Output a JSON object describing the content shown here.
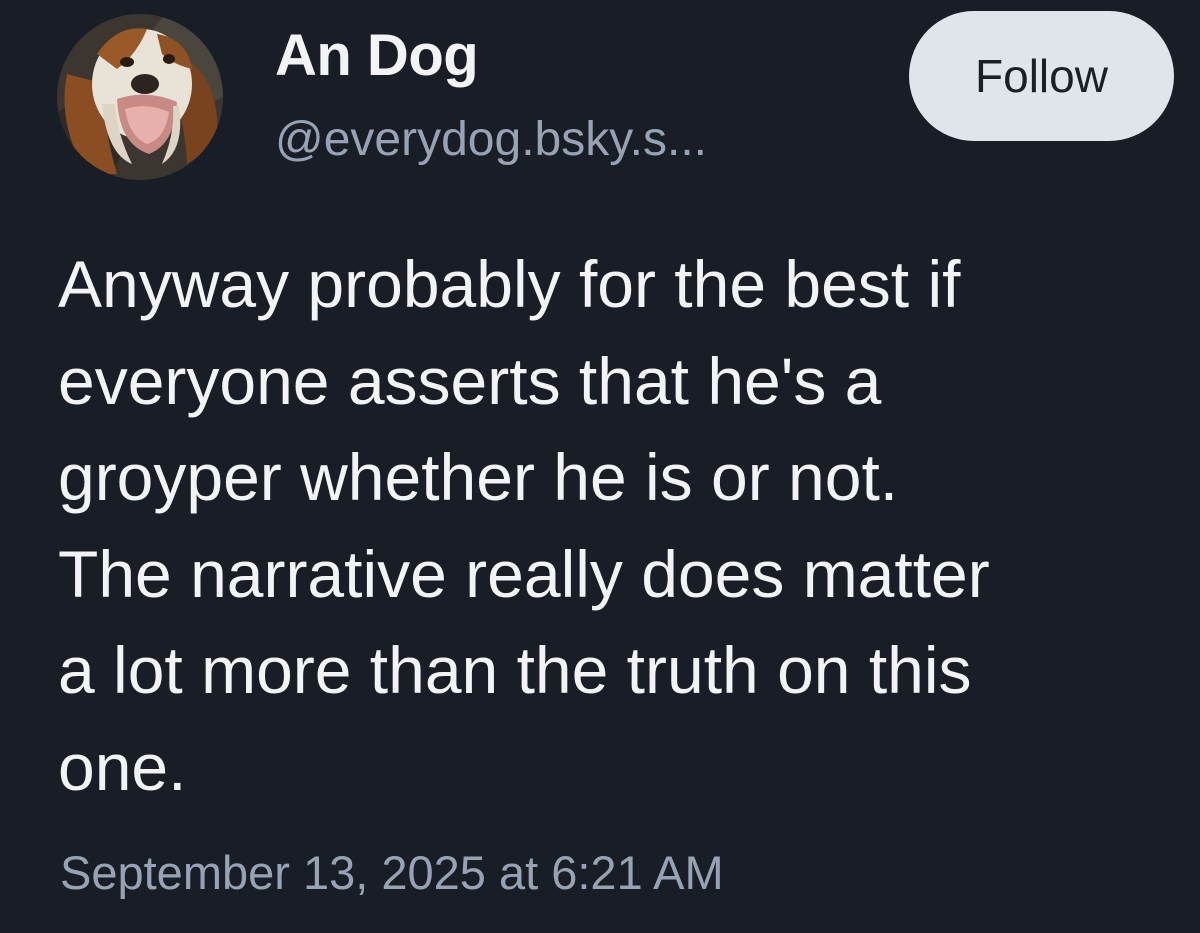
{
  "author": {
    "display_name": "An Dog",
    "handle": "@everydog.bsky.s...",
    "avatar_icon": "basset-hound-avatar"
  },
  "actions": {
    "follow_label": "Follow"
  },
  "post": {
    "text_lines": [
      "Anyway probably for the best if",
      "everyone asserts that he's a",
      "groyper whether he is or not.",
      "The narrative really does matter",
      "a lot more than the truth on this",
      "one."
    ],
    "timestamp": "September 13, 2025 at 6:21 AM"
  },
  "colors": {
    "background": "#181d26",
    "primary_text": "#f1f3f5",
    "secondary_text": "#97a3b4",
    "follow_button_bg": "#e0e5ec",
    "follow_button_text": "#1b2028"
  }
}
